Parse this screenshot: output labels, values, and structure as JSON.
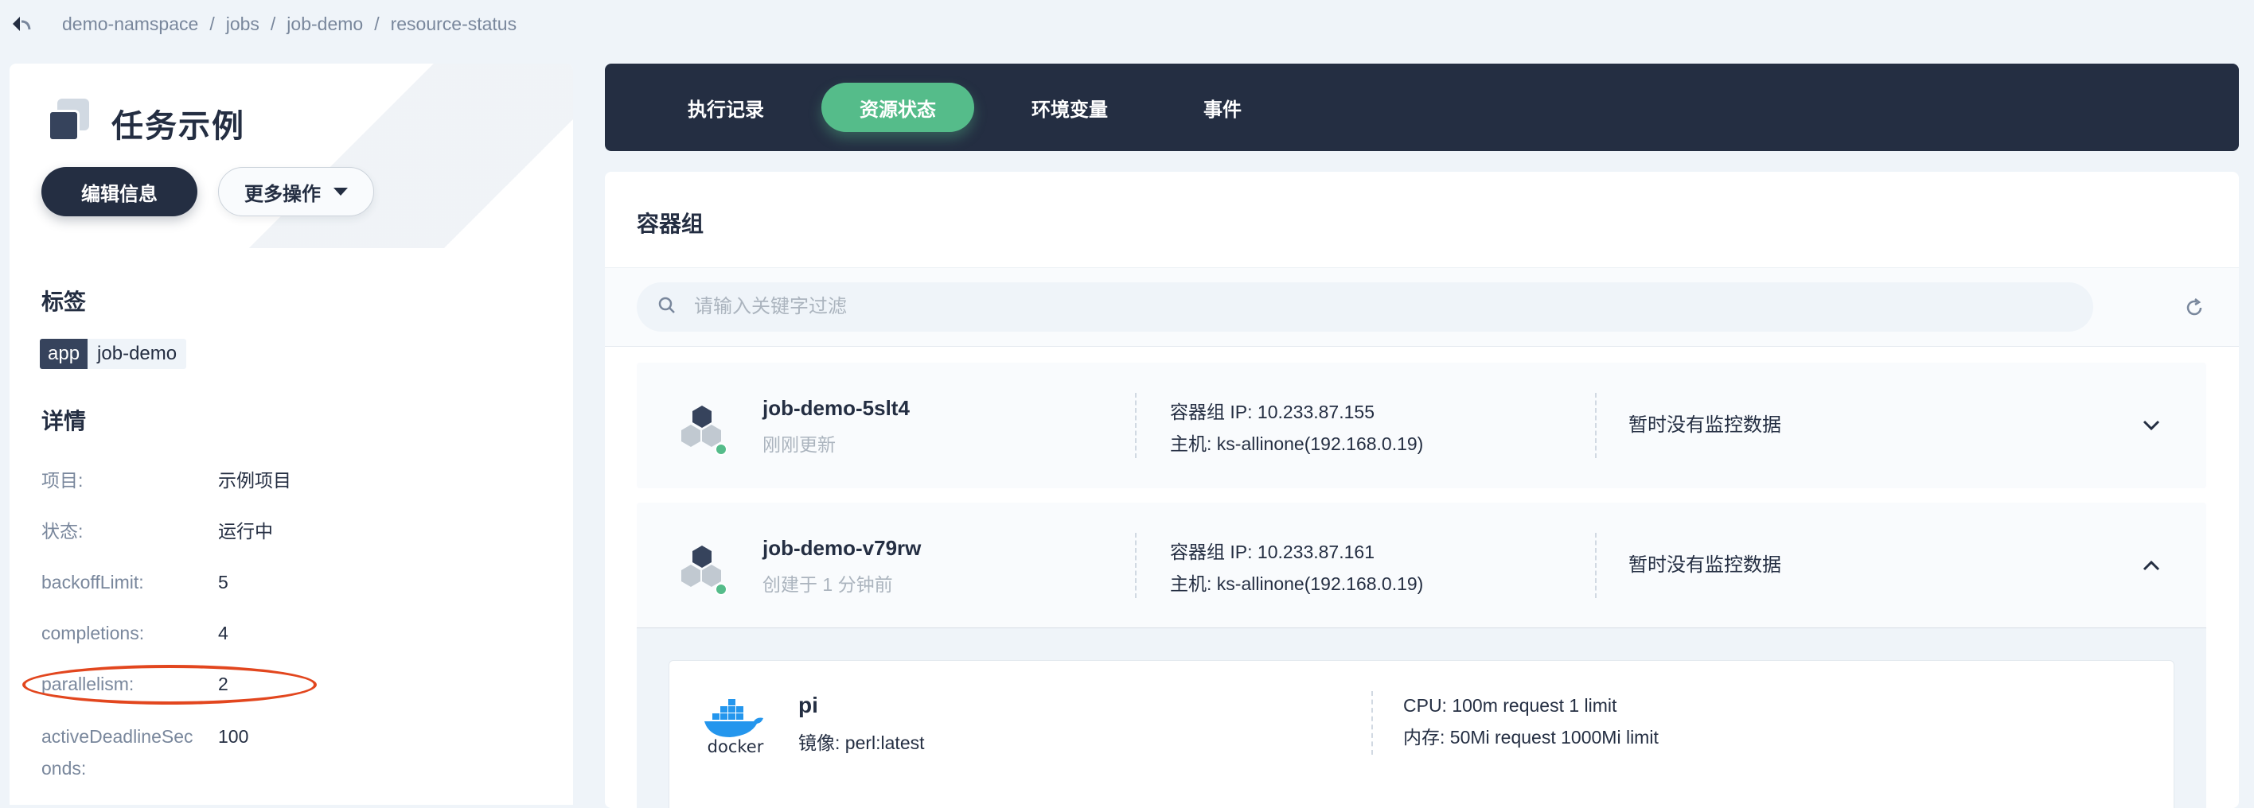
{
  "breadcrumb": [
    "demo-namspace",
    "jobs",
    "job-demo",
    "resource-status"
  ],
  "left": {
    "title": "任务示例",
    "edit_button": "编辑信息",
    "more_button": "更多操作",
    "labels_heading": "标签",
    "tag": {
      "key": "app",
      "value": "job-demo"
    },
    "details_heading": "详情",
    "details": [
      {
        "label": "项目:",
        "value": "示例项目"
      },
      {
        "label": "状态:",
        "value": "运行中"
      },
      {
        "label": "backoffLimit:",
        "value": "5"
      },
      {
        "label": "completions:",
        "value": "4"
      },
      {
        "label": "parallelism:",
        "value": "2"
      },
      {
        "label": "activeDeadlineSec",
        "label2": "onds:",
        "value": "100"
      }
    ]
  },
  "tabs": [
    {
      "label": "执行记录",
      "active": false
    },
    {
      "label": "资源状态",
      "active": true
    },
    {
      "label": "环境变量",
      "active": false
    },
    {
      "label": "事件",
      "active": false
    }
  ],
  "main": {
    "section_title": "容器组",
    "search_placeholder": "请输入关键字过滤",
    "pods": [
      {
        "name": "job-demo-5slt4",
        "sub": "刚刚更新",
        "ip": "容器组 IP: 10.233.87.155",
        "host": "主机: ks-allinone(192.168.0.19)",
        "monitor": "暂时没有监控数据",
        "expanded": false
      },
      {
        "name": "job-demo-v79rw",
        "sub": "创建于 1 分钟前",
        "ip": "容器组 IP: 10.233.87.161",
        "host": "主机: ks-allinone(192.168.0.19)",
        "monitor": "暂时没有监控数据",
        "expanded": true
      }
    ],
    "container": {
      "name": "pi",
      "image": "镜像: perl:latest",
      "cpu": "CPU: 100m request 1 limit",
      "memory": "内存: 50Mi request 1000Mi limit",
      "logo_text": "docker"
    }
  },
  "colors": {
    "accent": "#55bc8a",
    "dark": "#242e42",
    "annotation": "#e2461e"
  },
  "icons": [
    "back-icon",
    "task-icon",
    "caret-down-icon",
    "search-icon",
    "refresh-icon",
    "pod-icon",
    "chevron-down-icon",
    "chevron-up-icon",
    "docker-icon"
  ]
}
